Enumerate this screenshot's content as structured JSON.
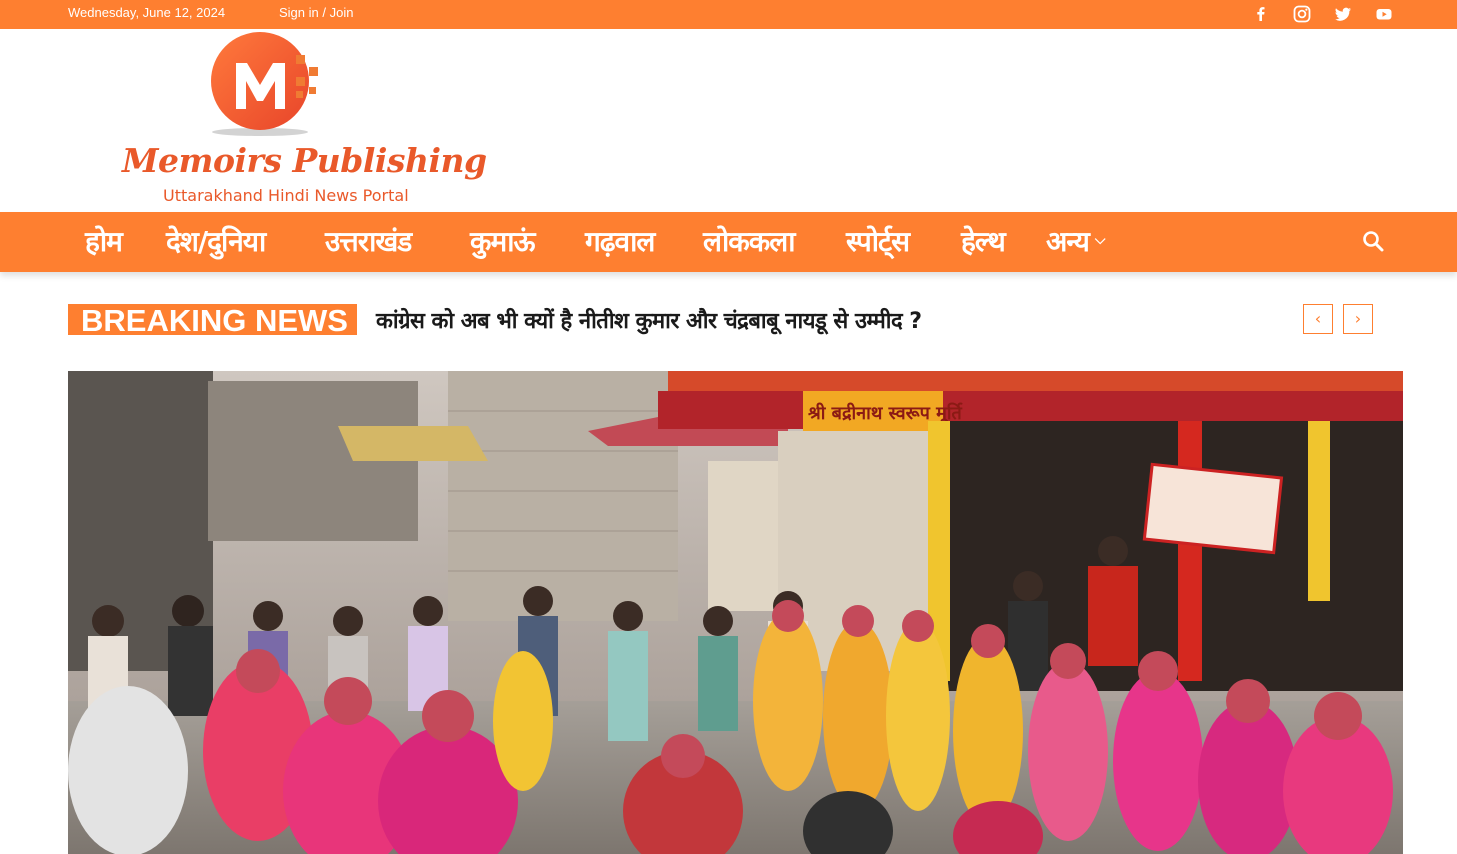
{
  "topbar": {
    "date": "Wednesday, June 12, 2024",
    "signin": "Sign in / Join",
    "social": [
      "facebook-icon",
      "instagram-icon",
      "twitter-icon",
      "youtube-icon"
    ]
  },
  "brand": {
    "name": "Memoirs Publishing",
    "tagline": "Uttarakhand Hindi News Portal",
    "color": "#fe7f30"
  },
  "nav": {
    "items": [
      "होम",
      "देश/दुनिया",
      "उत्तराखंड",
      "कुमाऊं",
      "गढ़वाल",
      "लोककला",
      "स्पोर्ट्स",
      "हेल्थ",
      "अन्य"
    ]
  },
  "breaking": {
    "label": "BREAKING NEWS",
    "headline": "कांग्रेस को अब भी क्यों है नीतीश कुमार और चंद्रबाबू नायडू से उम्मीद ?",
    "prev": "‹",
    "next": "›"
  },
  "signboard": {
    "title": "श्री बद्रीनाथ स्वरूप मूर्ति"
  }
}
